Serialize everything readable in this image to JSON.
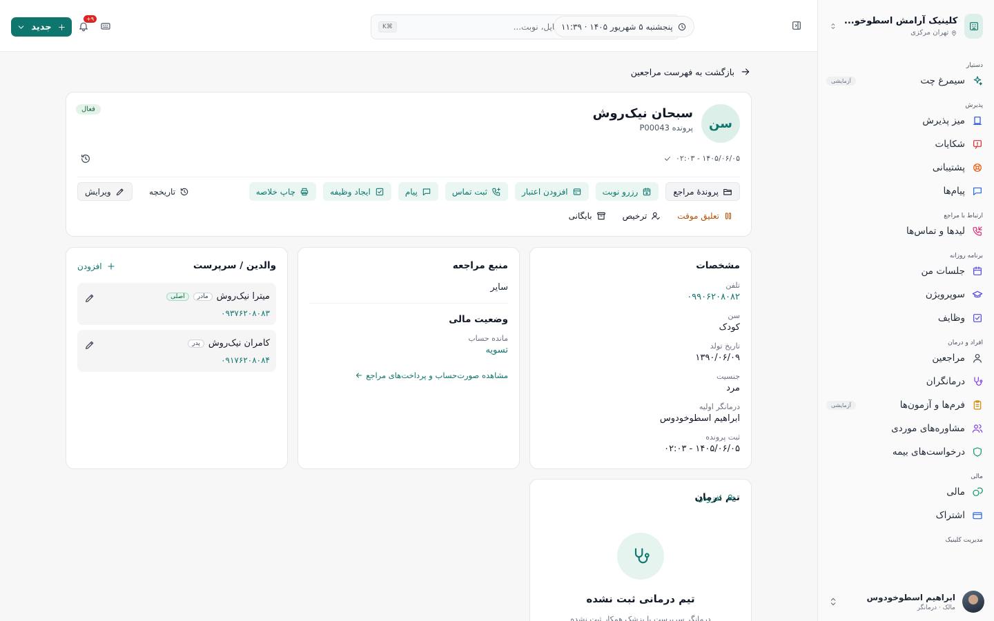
{
  "sidebar": {
    "clinic_name": "کلینیک آرامش اسطوخو...",
    "clinic_location": "تهران مرکزی",
    "sections": {
      "assistant": "دستیار",
      "reception": "پذیرش",
      "client_comm": "ارتباط با مراجع",
      "daily": "برنامه روزانه",
      "people": "افراد و درمان",
      "finance": "مالی",
      "management": "مدیریت کلینیک"
    },
    "items": {
      "simorgh": "سیمرغ چت",
      "trial_badge": "آزمایشی",
      "reception_desk": "میز پذیرش",
      "complaints": "شکایات",
      "support": "پشتیبانی",
      "messages": "پیام‌ها",
      "leads": "لیدها و تماس‌ها",
      "my_sessions": "جلسات من",
      "supervision": "سوپرویژن",
      "tasks": "وظایف",
      "clients": "مراجعین",
      "therapists": "درمانگران",
      "forms": "فرم‌ها و آزمون‌ها",
      "forms_badge": "آزمایشی",
      "case_consult": "مشاوره‌های موردی",
      "insurance": "درخواست‌های بیمه",
      "finance": "مالی",
      "subscription": "اشتراک"
    },
    "user": {
      "name": "ابراهیم اسطوخودوس",
      "role": "مالک · درمانگر"
    }
  },
  "topbar": {
    "search_placeholder": "جست‌وجوی مراجع، شماره، فایل، نوبت...",
    "search_kbd": "⌘K",
    "datetime": "پنجشنبه ۵ شهریور ۱۴۰۵ · ۱۱:۳۹",
    "notif_badge": "۹+",
    "new_label": "جدید"
  },
  "back_label": "بازگشت به فهرست مراجعین",
  "profile": {
    "initials": "سن",
    "name": "سبحان نیک‌روش",
    "file": "پرونده P00043",
    "status": "فعال",
    "stamp": "۱۴۰۵/۰۶/۰۵ - ۰۲:۰۳",
    "actions": {
      "file": "پروندهٔ مراجع",
      "book": "رزرو نوبت",
      "credit": "افزودن اعتبار",
      "call": "ثبت تماس",
      "message": "پیام",
      "task": "ایجاد وظیفه",
      "print": "چاپ خلاصه",
      "history": "تاریخچه",
      "edit": "ویرایش",
      "suspend": "تعلیق موقت",
      "discharge": "ترخیص",
      "archive": "بایگانی"
    }
  },
  "specs": {
    "title": "مشخصات",
    "fields": [
      {
        "label": "تلفن",
        "value": "۰۹۹۰۶۲۰۸۰۸۲"
      },
      {
        "label": "سن",
        "value": "کودک"
      },
      {
        "label": "تاریخ تولد",
        "value": "۱۳۹۰/۰۶/۰۹"
      },
      {
        "label": "جنسیت",
        "value": "مرد"
      },
      {
        "label": "درمانگر اولیه",
        "value": "ابراهیم اسطوخودوس"
      },
      {
        "label": "ثبت پرونده",
        "value": "۱۴۰۵/۰۶/۰۵ - ۰۲:۰۳"
      }
    ]
  },
  "source": {
    "title": "منبع مراجعه",
    "value": "سایر",
    "finance_title": "وضعیت مالی",
    "balance_label": "مانده حساب",
    "balance_value": "تسویه",
    "link": "مشاهده صورت‌حساب و پرداخت‌های مراجع"
  },
  "parents": {
    "title": "والدین / سرپرست",
    "add": "افزودن",
    "rows": [
      {
        "name": "میترا نیک‌روش",
        "relation": "مادر",
        "main": "اصلی",
        "phone": "۰۹۳۷۶۲۰۸۰۸۳"
      },
      {
        "name": "کامران نیک‌روش",
        "relation": "پدر",
        "main": "",
        "phone": "۰۹۱۷۶۲۰۸۰۸۴"
      }
    ]
  },
  "team": {
    "title": "تیم درمان",
    "add": "افزودن",
    "empty": "تیم درمانی ثبت نشده",
    "sub": "درمانگر سرپرست یا پزشک همکار ثبت نشده"
  },
  "colors": {
    "accent": "#0f766e",
    "warn": "#b45309",
    "badge": "#dc2626"
  }
}
